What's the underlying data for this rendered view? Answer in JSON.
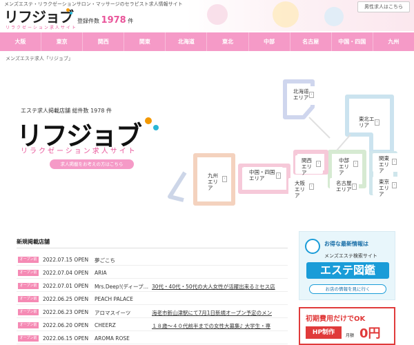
{
  "header": {
    "tagline": "メンズエステ・リラクゼーションサロン・マッサージのセラピスト求人情報サイト",
    "logo": "リフジョブ",
    "logo_sub": "リラクゼーション求人サイト",
    "count_label": "登録件数",
    "count": "1978",
    "count_unit": "件",
    "search_button": "男性求人はこちら"
  },
  "nav": [
    "大阪",
    "東京",
    "関西",
    "関東",
    "北海道",
    "東北",
    "中部",
    "名古屋",
    "中国・四国",
    "九州"
  ],
  "breadcrumb": "メンズエステ求人「リジョブ」",
  "hero": {
    "caption": "エステ求人掲載店舗 総件数 1978 件",
    "logo": "リフジョブ",
    "sub": "リラクゼーション求人サイト",
    "button": "求人掲載をお考えの方はこちら"
  },
  "regions": {
    "hokkaido": "北海道エリア",
    "tohoku": "東北エリア",
    "kanto": "関東エリア",
    "tokyo": "東京エリア",
    "chubu": "中部エリア",
    "nagoya": "名古屋エリア",
    "kansai": "関西エリア",
    "osaka": "大阪エリア",
    "chugoku": "中国・四国エリア",
    "kyushu": "九州エリア"
  },
  "new_listings": {
    "title": "新規掲載店舗",
    "badge": "オープン前",
    "rows": [
      {
        "date": "2022.07.15 OPEN",
        "name": "夢ごこち",
        "desc": ""
      },
      {
        "date": "2022.07.04 OPEN",
        "name": "ARIA",
        "desc": ""
      },
      {
        "date": "2022.07.01 OPEN",
        "name": "Mrs.Deep!(ディープ…",
        "desc": "30代・40代・50代の大人女性が活躍出来るミセス店"
      },
      {
        "date": "2022.06.25 OPEN",
        "name": "PEACH PALACE",
        "desc": ""
      },
      {
        "date": "2022.06.23 OPEN",
        "name": "アロマスイーツ",
        "desc": "海老市新山津駅にて7月1日新規オープン予定のメン"
      },
      {
        "date": "2022.06.20 OPEN",
        "name": "CHEERZ",
        "desc": "１８歳～４０代前半までの女性大募集♪ 大学生・専"
      },
      {
        "date": "2022.06.15 OPEN",
        "name": "AROMA ROSE",
        "desc": ""
      }
    ]
  },
  "ads": {
    "ad1_top": "お得な最新情報は",
    "ad1_mid": "メンズエステ検索サイト",
    "ad1_title": "エステ図鑑",
    "ad1_btn": "お店の情報を見に行く",
    "ad2_top": "初期費用だけでOK",
    "ad2_mid": "HP制作",
    "ad2_sub": "月額",
    "ad2_price": "0円"
  },
  "colors": {
    "nav_bg": "#f59ac7",
    "accent": "#e9559a",
    "ad_blue": "#1a9cd8",
    "ad_red": "#e03a3a"
  }
}
